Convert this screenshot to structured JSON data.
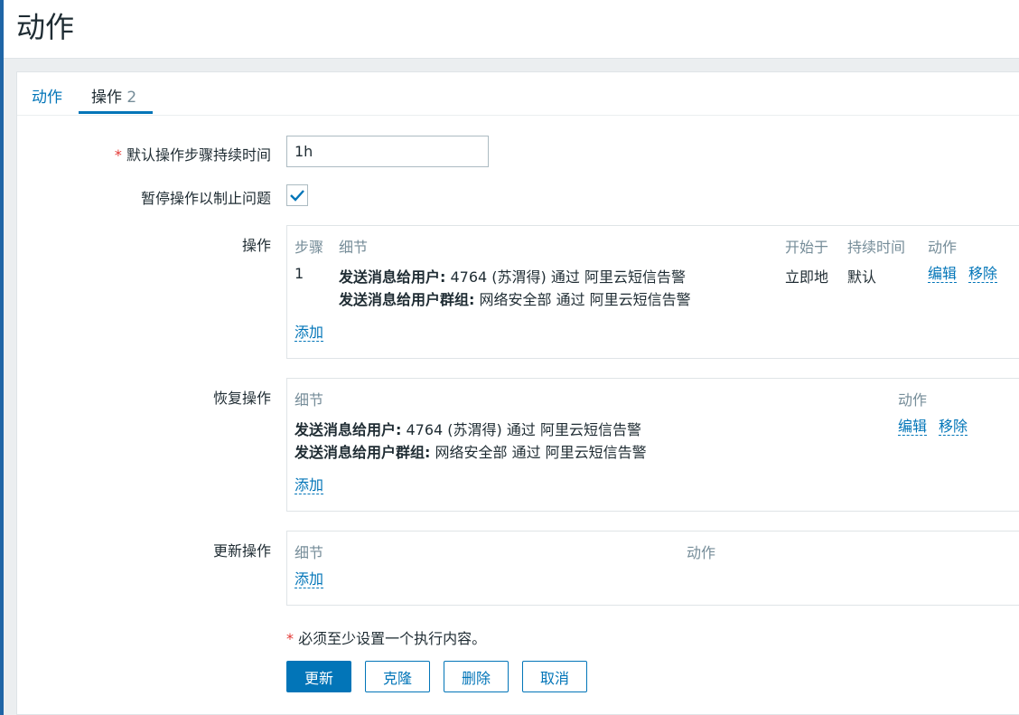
{
  "page": {
    "title": "动作"
  },
  "tabs": [
    {
      "label": "动作"
    },
    {
      "label": "操作",
      "count": "2"
    }
  ],
  "form": {
    "step_duration": {
      "required_mark": "*",
      "label": "默认操作步骤持续时间",
      "value": "1h"
    },
    "pause": {
      "label": "暂停操作以制止问题",
      "checked": true
    }
  },
  "operations": {
    "label": "操作",
    "headers": {
      "step": "步骤",
      "details": "细节",
      "start_in": "开始于",
      "duration": "持续时间",
      "action": "动作"
    },
    "rows": [
      {
        "step": "1",
        "details": [
          {
            "bold": "发送消息给用户:",
            "text": " 4764 (苏渭得) 通过 阿里云短信告警"
          },
          {
            "bold": "发送消息给用户群组:",
            "text": " 网络安全部 通过 阿里云短信告警"
          }
        ],
        "start_in": "立即地",
        "duration": "默认",
        "edit": "编辑",
        "remove": "移除"
      }
    ],
    "add": "添加"
  },
  "recovery": {
    "label": "恢复操作",
    "headers": {
      "details": "细节",
      "action": "动作"
    },
    "rows": [
      {
        "details": [
          {
            "bold": "发送消息给用户:",
            "text": " 4764 (苏渭得) 通过 阿里云短信告警"
          },
          {
            "bold": "发送消息给用户群组:",
            "text": " 网络安全部 通过 阿里云短信告警"
          }
        ],
        "edit": "编辑",
        "remove": "移除"
      }
    ],
    "add": "添加"
  },
  "update": {
    "label": "更新操作",
    "headers": {
      "details": "细节",
      "action": "动作"
    },
    "add": "添加"
  },
  "note": {
    "mark": "*",
    "text": " 必须至少设置一个执行内容。"
  },
  "buttons": {
    "update": "更新",
    "clone": "克隆",
    "delete": "删除",
    "cancel": "取消"
  },
  "colors": {
    "accent": "#0275b8",
    "required": "#e33734",
    "muted": "#768d99"
  }
}
